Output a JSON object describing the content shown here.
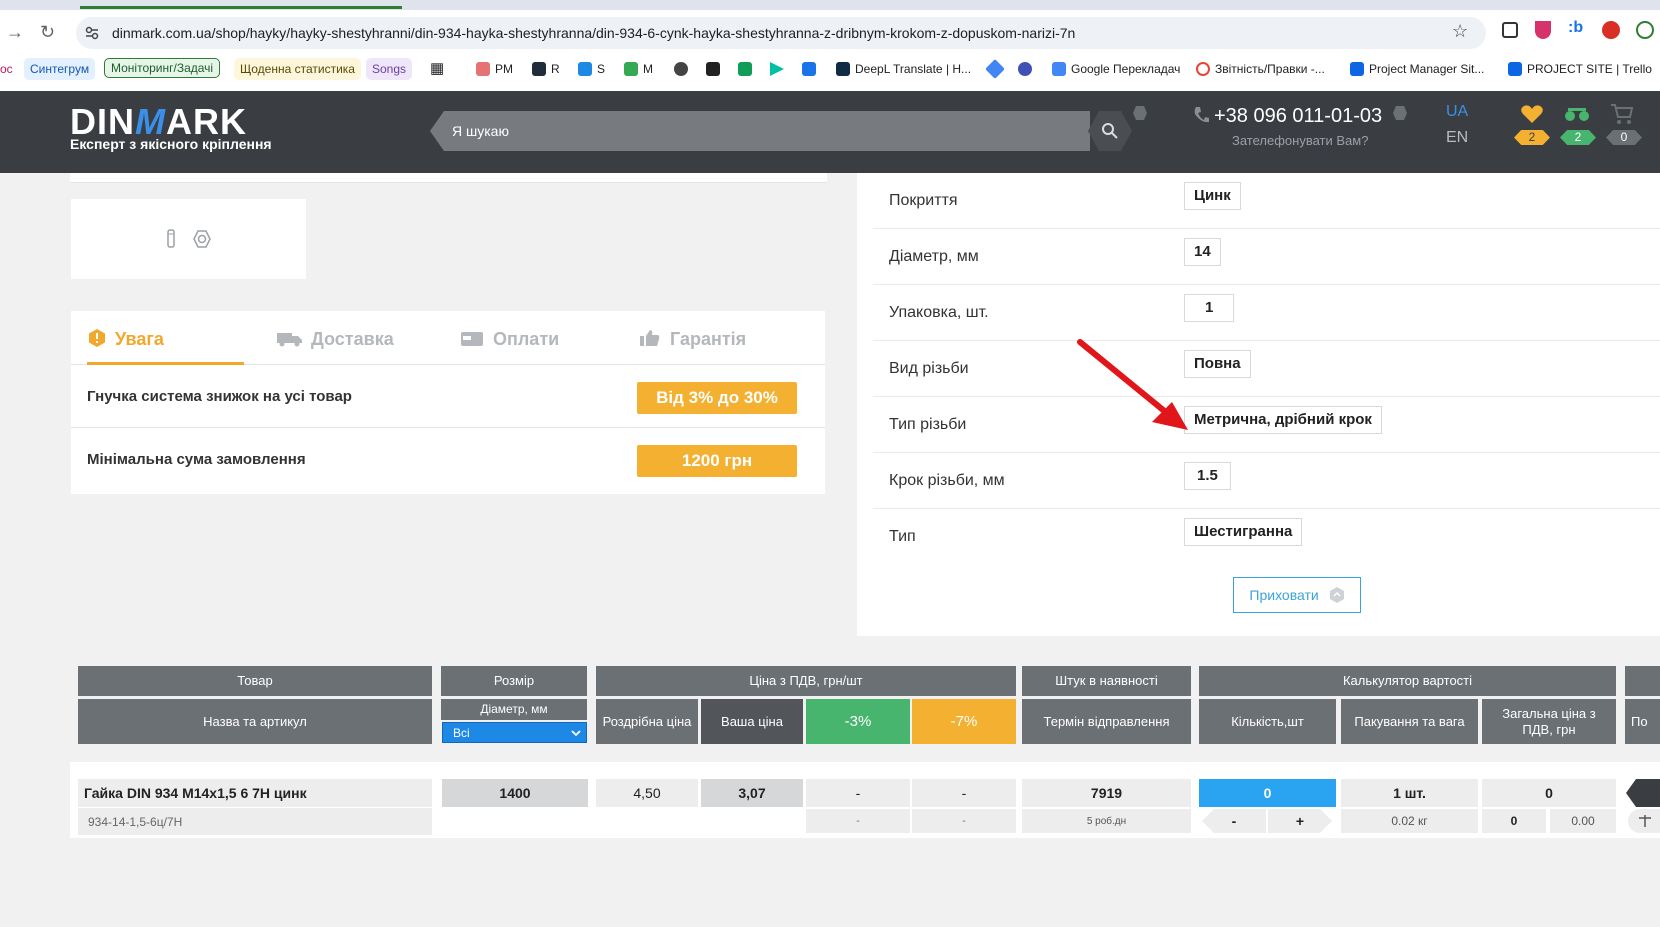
{
  "browser": {
    "url": "dinmark.com.ua/shop/hayky/hayky-shestyhranni/din-934-hayka-shestyhranna/din-934-6-cynk-hayka-shestyhranna-z-dribnym-krokom-z-dopuskom-narizi-7n",
    "bookmarks": {
      "partial": "oc",
      "syntegrum": "Синтегрум",
      "monitoring": "Моніторинг/Задачі",
      "daily": "Щоденна статистика",
      "songs": "Songs",
      "pm": "PM",
      "r": "R",
      "s": "S",
      "m": "M",
      "deepl": "DeepL Translate | H...",
      "google_translate": "Google Перекладач",
      "reports": "Звітність/Правки -...",
      "pm_site": "Project Manager Sit...",
      "trello": "PROJECT SITE | Trello"
    }
  },
  "header": {
    "logo_left": "DIN",
    "logo_mid": "M",
    "logo_right": "ARK",
    "tagline": "Експерт з якісного кріплення",
    "search_placeholder": "Я шукаю",
    "phone": "+38 096 011-01-03",
    "callback": "Зателефонувати Вам?",
    "lang_ua": "UA",
    "lang_en": "EN",
    "favorites_count": "2",
    "compare_count": "2",
    "cart_count": "0"
  },
  "tabs": {
    "attention": "Увага",
    "delivery": "Доставка",
    "payments": "Оплати",
    "warranty": "Гарантія"
  },
  "info_rows": [
    {
      "text": "Гнучка система знижок на усі товар",
      "badge": "Від 3% до 30%"
    },
    {
      "text": "Мінімальна сума замовлення",
      "badge": "1200 грн"
    }
  ],
  "specs": [
    {
      "label": "Покриття",
      "value": "Цинк"
    },
    {
      "label": "Діаметр, мм",
      "value": "14"
    },
    {
      "label": "Упаковка, шт.",
      "value": "1"
    },
    {
      "label": "Вид різьби",
      "value": "Повна"
    },
    {
      "label": "Тип різьби",
      "value": "Метрична, дрібний крок"
    },
    {
      "label": "Крок різьби, мм",
      "value": "1.5"
    },
    {
      "label": "Тип",
      "value": "Шестигранна"
    }
  ],
  "hide_button": "Приховати",
  "table": {
    "h_product": "Товар",
    "h_size": "Розмір",
    "h_price": "Ціна з ПДВ, грн/шт",
    "h_stock": "Штук в наявності",
    "h_calc": "Калькулятор вартості",
    "h_name": "Назва та артикул",
    "h_diameter": "Діаметр, мм",
    "diameter_select": "Всі",
    "h_retail": "Роздрібна ціна",
    "h_your_price": "Ваша ціна",
    "h_minus3": "-3%",
    "h_minus7": "-7%",
    "h_ship": "Термін відправлення",
    "h_qty": "Кількість,шт",
    "h_pack": "Пакування та вага",
    "h_total": "Загальна ціна з ПДВ, грн",
    "h_partial": "По",
    "row": {
      "name": "Гайка DIN 934 М14х1,5 6 7Н цинк",
      "sku": "934-14-1,5-6ц/7Н",
      "size": "1400",
      "retail": "4,50",
      "your_price": "3,07",
      "p3": "-",
      "p7": "-",
      "p3_sub": "-",
      "p7_sub": "-",
      "stock": "7919",
      "ship": "5 роб.дн",
      "qty": "0",
      "minus": "-",
      "plus": "+",
      "pack": "1 шт.",
      "weight": "0.02 кг",
      "total": "0",
      "total_a": "0",
      "total_b": "0.00"
    }
  },
  "colors": {
    "accent_orange": "#f4b030",
    "accent_blue": "#3b8fe8",
    "green": "#47b56e",
    "header_bg": "#3a3d42",
    "annotation_arrow": "#e0161b"
  }
}
